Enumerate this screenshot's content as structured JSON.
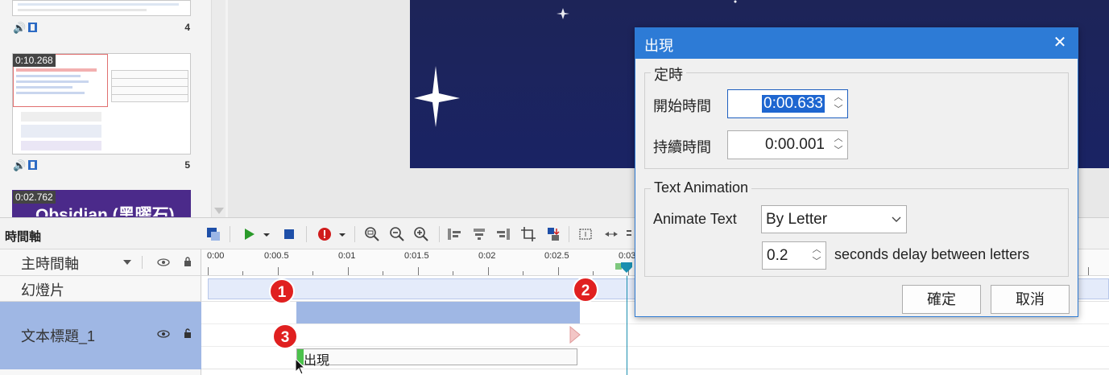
{
  "thumbnails": [
    {
      "number": "4"
    },
    {
      "time": "0:10.268",
      "number": "5",
      "caption_red": "看到這裡的你"
    },
    {
      "time": "0:02.762",
      "title": "Obsidian (黑曜石)"
    }
  ],
  "timeline": {
    "title": "時間軸",
    "main_track": "主時間軸",
    "slide_track": "幻燈片",
    "text_track": "文本標題_1",
    "ticks": [
      "0:00",
      "0:00.5",
      "0:01",
      "0:01.5",
      "0:02",
      "0:02.5",
      "0:03"
    ],
    "effect_label": "出現",
    "markers": [
      "1",
      "2",
      "3"
    ]
  },
  "dialog": {
    "title": "出現",
    "timing_group": "定時",
    "start_label": "開始時間",
    "start_value": "0:00.633",
    "duration_label": "持續時間",
    "duration_value": "0:00.001",
    "text_anim_group": "Text Animation",
    "animate_label": "Animate Text",
    "animate_value": "By Letter",
    "delay_value": "0.2",
    "delay_suffix": "seconds delay between letters",
    "ok_label": "確定",
    "cancel_label": "取消"
  },
  "colors": {
    "accent": "#2d7bd6",
    "stage": "#1d2458",
    "track_fill": "#9fb7e4",
    "marker_red": "#e02020"
  }
}
